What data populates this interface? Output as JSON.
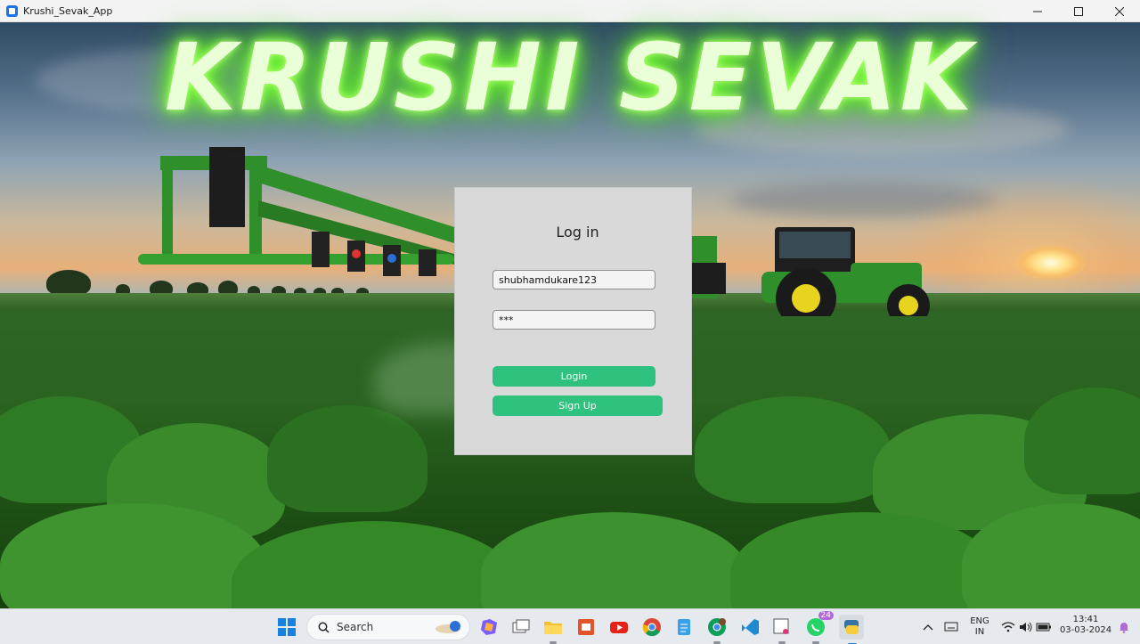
{
  "window": {
    "title": "Krushi_Sevak_App"
  },
  "app_title": "KRUSHI SEVAK",
  "login": {
    "heading": "Log in",
    "username_value": "shubhamdukare123",
    "password_value": "***",
    "login_label": "Login",
    "signup_label": "Sign Up"
  },
  "taskbar": {
    "search_label": "Search",
    "whatsapp_badge": "24",
    "lang_top": "ENG",
    "lang_bottom": "IN",
    "time": "13:41",
    "date": "03-03-2024"
  },
  "colors": {
    "accent_button": "#2ec27e",
    "title_glow": "#7dff3a",
    "panel_bg": "#d9d9d9"
  }
}
